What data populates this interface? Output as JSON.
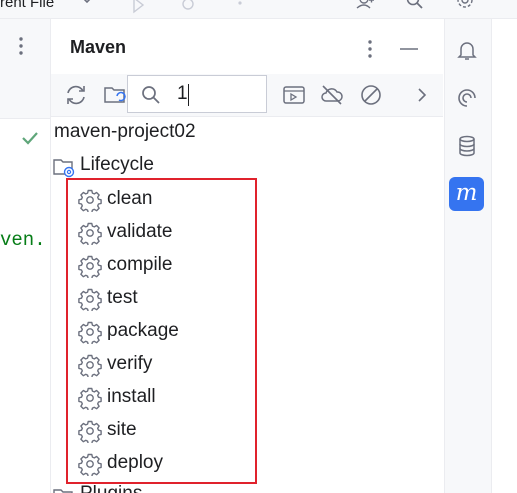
{
  "topbar": {
    "file_label": "rent File",
    "icons": [
      "chevron-down-icon",
      "run-icon",
      "debug-icon",
      "more-icon",
      "add-user-icon",
      "search-icon",
      "settings-icon"
    ]
  },
  "editor": {
    "code_fragment": "ven.",
    "check_icon": "check-icon",
    "accent_green": "#067d17"
  },
  "maven": {
    "title": "Maven",
    "toolbar": {
      "icons": [
        "reload-icon",
        "generate-sources-icon",
        "run-config-icon",
        "offline-icon",
        "skip-tests-icon",
        "chevron-right-icon"
      ]
    },
    "search": {
      "value": "1",
      "icon": "search-icon"
    },
    "tree": {
      "project": "maven-project02",
      "lifecycle": {
        "label": "Lifecycle",
        "goals": [
          "clean",
          "validate",
          "compile",
          "test",
          "package",
          "verify",
          "install",
          "site",
          "deploy"
        ]
      },
      "plugins": "Plugins"
    }
  },
  "right_strip": {
    "icons": [
      "notifications-icon",
      "ai-assistant-icon",
      "database-icon",
      "maven-icon"
    ],
    "maven_letter": "m",
    "active_color": "#3574f0"
  },
  "highlight_color": "#e0222c"
}
